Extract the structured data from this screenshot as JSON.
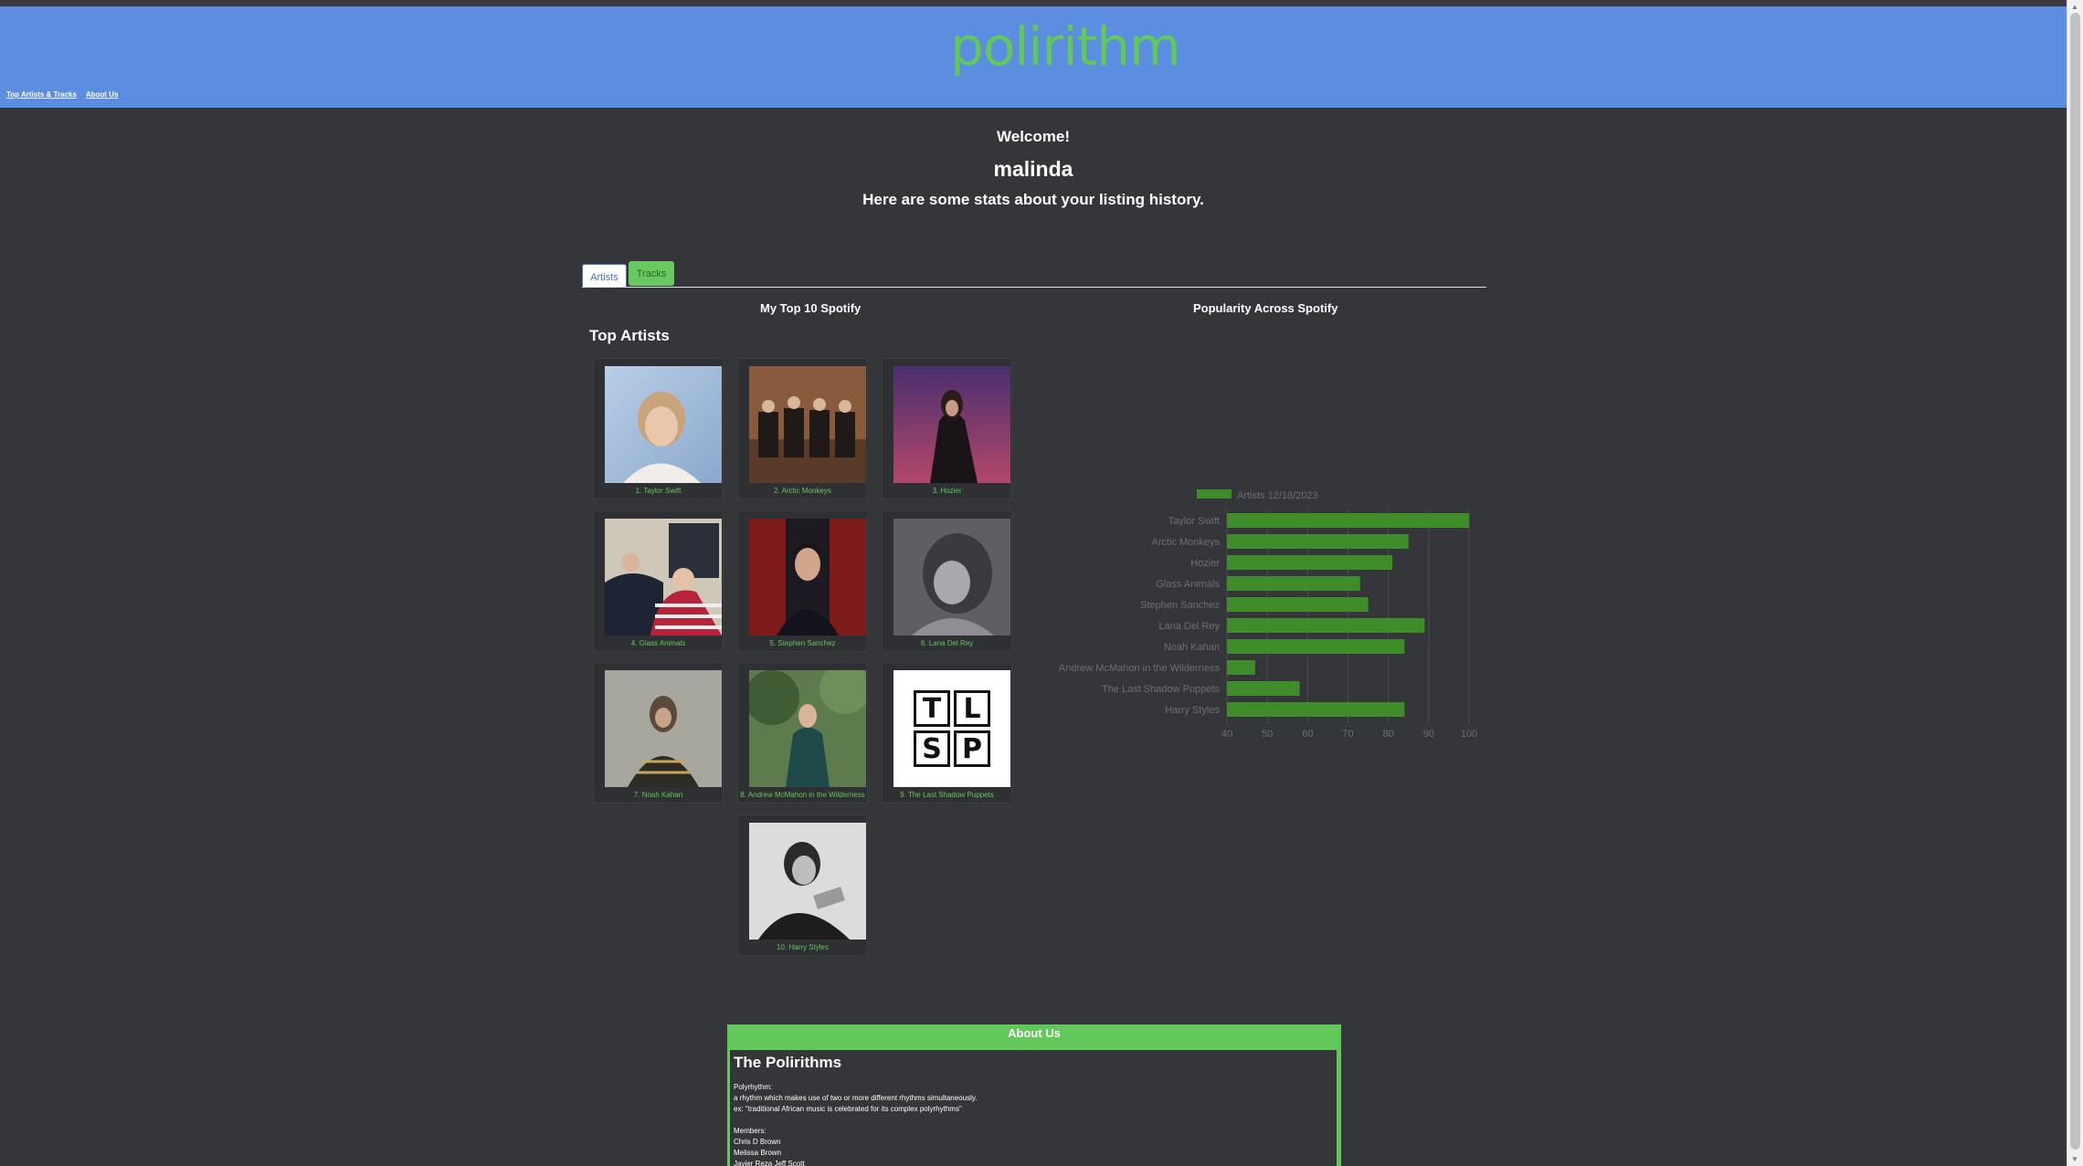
{
  "header": {
    "logo": "polirithm",
    "nav": [
      "Top Artists & Tracks",
      "About Us"
    ],
    "colors": {
      "header_bg": "#5b8de0",
      "accent": "#63c85a",
      "page_bg": "#35363a"
    }
  },
  "welcome": {
    "greeting": "Welcome!",
    "username": "malinda",
    "subtitle": "Here are some stats about your listing history."
  },
  "tabs": [
    "Artists",
    "Tracks"
  ],
  "sections": {
    "top10_title": "My Top 10 Spotify",
    "popularity_title": "Popularity Across Spotify",
    "top_artists_heading": "Top Artists"
  },
  "artists": [
    "1. Taylor Swift",
    "2. Arctic Monkeys",
    "3. Hozier",
    "4. Glass Animals",
    "5. Stephen Sanchez",
    "6. Lana Del Rey",
    "7. Noah Kahan",
    "8. Andrew McMahon in the Wilderness",
    "9. The Last Shadow Puppets",
    "10. Harry Styles"
  ],
  "tlsp_logo": [
    "T",
    "L",
    "S",
    "P"
  ],
  "chart_data": {
    "type": "bar",
    "orientation": "horizontal",
    "categories": [
      "Taylor Swift",
      "Arctic Monkeys",
      "Hozier",
      "Glass Animals",
      "Stephen Sanchez",
      "Lana Del Rey",
      "Noah Kahan",
      "Andrew McMahon in the Wilderness",
      "The Last Shadow Puppets",
      "Harry Styles"
    ],
    "series": [
      {
        "name": "Artists 12/18/2023",
        "values": [
          100,
          85,
          81,
          73,
          75,
          89,
          84,
          47,
          58,
          84
        ],
        "color": "#3e8c2a"
      }
    ],
    "xlim": [
      40,
      100
    ],
    "xticks": [
      40,
      50,
      60,
      70,
      80,
      90,
      100
    ],
    "grid": true,
    "legend": "top-left"
  },
  "about": {
    "heading": "About Us",
    "title": "The Polirithms",
    "lines": [
      "Polyrhythm:",
      "a rhythm which makes use of two or more different rhythms simultaneously.",
      "ex: \"traditional African music is celebrated for its complex polyrhythms\"",
      "",
      "Members:",
      "Chris D Brown",
      "Melissa Brown",
      "Javier Reza Jeff Scott"
    ]
  }
}
